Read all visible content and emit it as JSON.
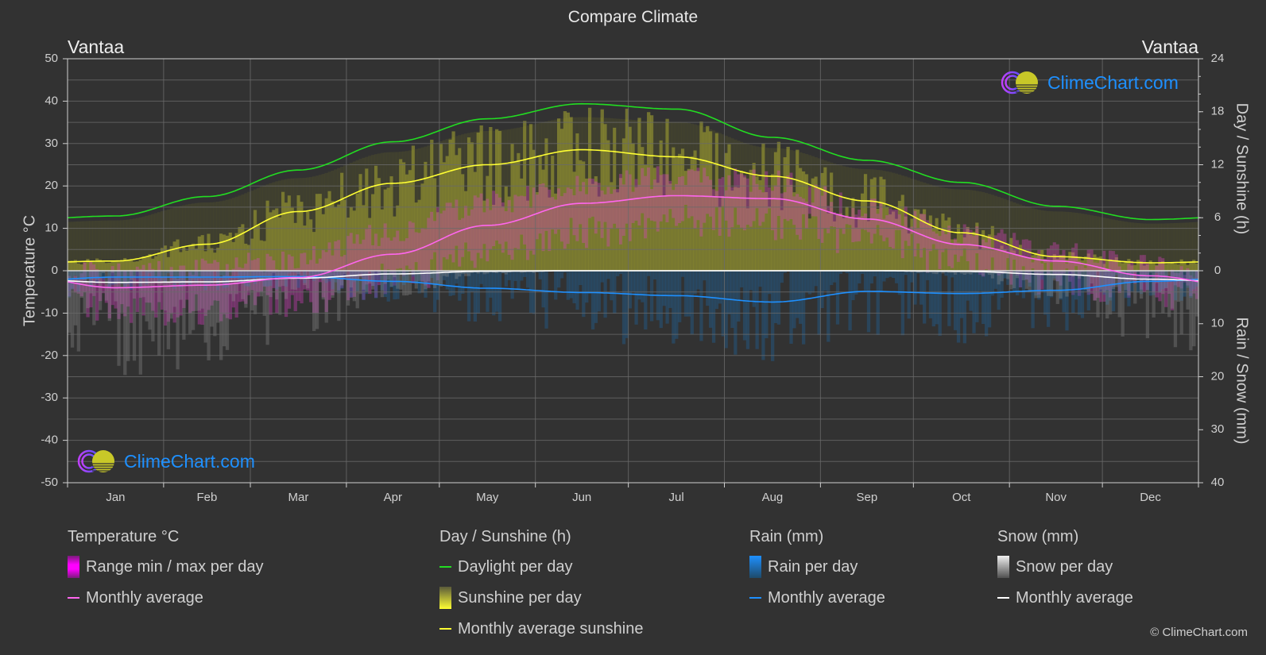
{
  "title": "Compare Climate",
  "location_left": "Vantaa",
  "location_right": "Vantaa",
  "logo_text": "ClimeChart.com",
  "copyright": "© ClimeChart.com",
  "colors": {
    "background": "#323232",
    "grid": "#5a5a5a",
    "temp_range": "#e040e0",
    "temp_avg": "#ff66ee",
    "daylight": "#22dd22",
    "sunshine_bar": "#c8c832",
    "sunshine_avg": "#ffff33",
    "rain_bar": "#1e78c8",
    "rain_avg": "#1e90ff",
    "snow_bar": "#b0b0b0",
    "snow_avg": "#ffffff",
    "logo_blue": "#1e90ff"
  },
  "legend": {
    "temperature": {
      "title": "Temperature °C",
      "items": [
        "Range min / max per day",
        "Monthly average"
      ]
    },
    "sunshine": {
      "title": "Day / Sunshine (h)",
      "items": [
        "Daylight per day",
        "Sunshine per day",
        "Monthly average sunshine"
      ]
    },
    "rain": {
      "title": "Rain (mm)",
      "items": [
        "Rain per day",
        "Monthly average"
      ]
    },
    "snow": {
      "title": "Snow (mm)",
      "items": [
        "Snow per day",
        "Monthly average"
      ]
    }
  },
  "chart_data": {
    "type": "line",
    "title": "Compare Climate",
    "categories": [
      "Jan",
      "Feb",
      "Mar",
      "Apr",
      "May",
      "Jun",
      "Jul",
      "Aug",
      "Sep",
      "Oct",
      "Nov",
      "Dec"
    ],
    "y_left": {
      "label": "Temperature °C",
      "range": [
        -50,
        50
      ],
      "ticks": [
        50,
        40,
        30,
        20,
        10,
        0,
        -10,
        -20,
        -30,
        -40,
        -50
      ]
    },
    "y_right_top": {
      "label": "Day / Sunshine (h)",
      "range": [
        0,
        24
      ],
      "ticks": [
        24,
        18,
        12,
        6,
        0
      ]
    },
    "y_right_bottom": {
      "label": "Rain / Snow (mm)",
      "range": [
        0,
        40
      ],
      "ticks": [
        0,
        10,
        20,
        30,
        40
      ]
    },
    "grid": true,
    "series": [
      {
        "name": "Temperature monthly average (°C)",
        "axis": "left",
        "values": [
          -4.0,
          -3.4,
          -1.6,
          3.9,
          10.7,
          15.9,
          17.7,
          17.0,
          12.2,
          6.2,
          2.3,
          -1.2
        ]
      },
      {
        "name": "Temperature daily max (approx °C)",
        "axis": "left",
        "values": [
          -1,
          0,
          3,
          9,
          16,
          20,
          22,
          21,
          15,
          9,
          4,
          1
        ]
      },
      {
        "name": "Temperature daily min (approx °C)",
        "axis": "left",
        "values": [
          -9,
          -9,
          -7,
          -2,
          4,
          9,
          12,
          11,
          7,
          2,
          -2,
          -5
        ]
      },
      {
        "name": "Daylight per day (h)",
        "axis": "right_top",
        "values": [
          6.2,
          8.4,
          11.4,
          14.6,
          17.2,
          18.9,
          18.3,
          15.1,
          12.5,
          10.0,
          7.3,
          5.8
        ]
      },
      {
        "name": "Monthly average sunshine (h)",
        "axis": "right_top",
        "values": [
          1.1,
          3.0,
          6.7,
          9.9,
          12.0,
          13.7,
          12.9,
          10.7,
          7.9,
          4.3,
          1.6,
          0.9
        ]
      },
      {
        "name": "Rain monthly average (mm/day)",
        "axis": "right_bottom",
        "values": [
          1.2,
          1.2,
          1.1,
          2.0,
          3.3,
          4.1,
          4.7,
          5.9,
          3.9,
          4.3,
          3.7,
          2.0
        ]
      },
      {
        "name": "Snow monthly average (mm/day)",
        "axis": "right_bottom",
        "values": [
          2.2,
          2.1,
          1.4,
          0.6,
          0.1,
          0.0,
          0.0,
          0.0,
          0.0,
          0.1,
          0.7,
          1.6
        ]
      }
    ]
  }
}
